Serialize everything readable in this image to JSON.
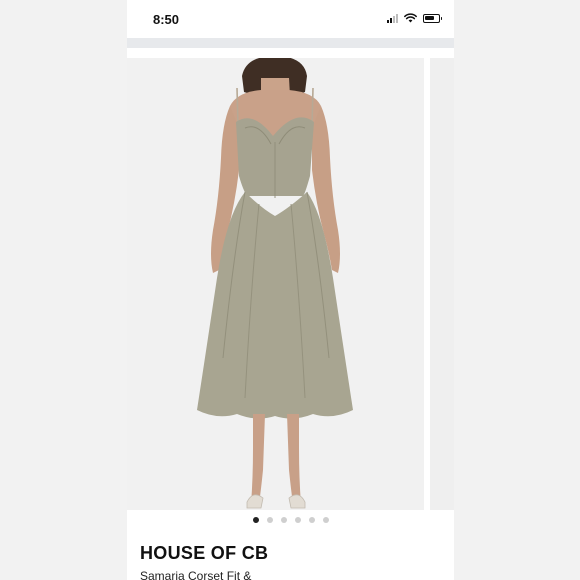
{
  "status_bar": {
    "time": "8:50"
  },
  "listing": {
    "brand": "HOUSE OF CB",
    "title": "Samaria Corset Fit &",
    "images": {
      "count": 6,
      "active_index": 0
    }
  },
  "colors": {
    "dress": "#a5a28f",
    "background": "#f3f3f3",
    "active_dot": "#222222",
    "inactive_dot": "#cfcfcf"
  }
}
